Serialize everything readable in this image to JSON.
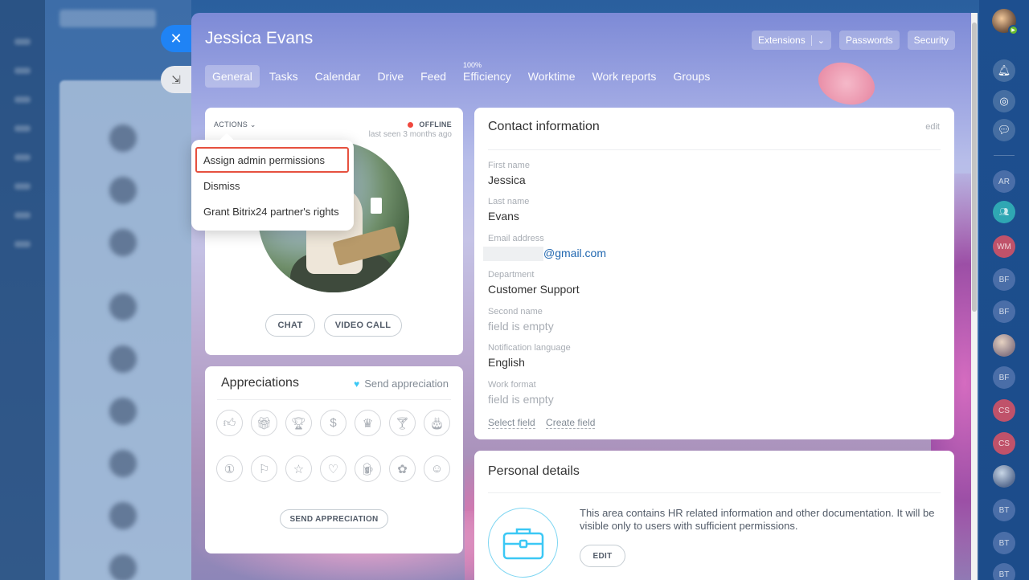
{
  "slider": {
    "title": "Jessica Evans",
    "close_icon": "close-icon",
    "minimize_icon": "minimize-icon",
    "top_buttons": {
      "extensions": "Extensions",
      "passwords": "Passwords",
      "security": "Security"
    },
    "tabs": [
      {
        "label": "General",
        "active": true
      },
      {
        "label": "Tasks"
      },
      {
        "label": "Calendar"
      },
      {
        "label": "Drive"
      },
      {
        "label": "Feed"
      },
      {
        "label": "Efficiency",
        "badge": "100%"
      },
      {
        "label": "Worktime"
      },
      {
        "label": "Work reports"
      },
      {
        "label": "Groups"
      }
    ]
  },
  "profile": {
    "actions_label": "ACTIONS",
    "status": "OFFLINE",
    "last_seen": "last seen 3 months ago",
    "chat_button": "CHAT",
    "video_call_button": "VIDEO CALL",
    "status_color": "#f0483e"
  },
  "actions_menu": {
    "items": [
      {
        "label": "Assign admin permissions",
        "highlighted": true
      },
      {
        "label": "Dismiss"
      },
      {
        "label": "Grant Bitrix24 partner's rights"
      }
    ]
  },
  "appreciations": {
    "title": "Appreciations",
    "send_link": "Send appreciation",
    "send_button": "SEND APPRECIATION",
    "icons": [
      "thumbs-up-icon",
      "gift-icon",
      "trophy-icon",
      "money-bag-icon",
      "crown-icon",
      "cocktail-icon",
      "cake-icon",
      "number-one-icon",
      "flag-icon",
      "star-icon",
      "heart-icon",
      "beer-icon",
      "flower-icon",
      "smile-icon"
    ]
  },
  "contact": {
    "title": "Contact information",
    "edit": "edit",
    "fields": {
      "first_name": {
        "label": "First name",
        "value": "Jessica"
      },
      "last_name": {
        "label": "Last name",
        "value": "Evans"
      },
      "email": {
        "label": "Email address",
        "value": "@gmail.com"
      },
      "department": {
        "label": "Department",
        "value": "Customer Support"
      },
      "second_name": {
        "label": "Second name",
        "value": "field is empty"
      },
      "notification_language": {
        "label": "Notification language",
        "value": "English"
      },
      "work_format": {
        "label": "Work format",
        "value": "field is empty"
      }
    },
    "select_field": "Select field",
    "create_field": "Create field"
  },
  "personal": {
    "title": "Personal details",
    "text": "This area contains HR related information and other documentation. It will be visible only to users with sufficient permissions.",
    "edit_button": "EDIT",
    "accent": "#3bc8f5"
  },
  "right_bar": {
    "users": [
      {
        "initials": "AR",
        "color": "#4a6ea8"
      },
      {
        "initials": "",
        "color": "#2fa7b3",
        "icon": "group-icon"
      },
      {
        "initials": "WM",
        "color": "#c0526a"
      },
      {
        "initials": "BF",
        "color": "#4a6ea8"
      },
      {
        "initials": "BF",
        "color": "#4a6ea8"
      },
      {
        "initials": "",
        "color": "#7b8aa6",
        "icon": "avatar-photo"
      },
      {
        "initials": "BF",
        "color": "#4a6ea8"
      },
      {
        "initials": "CS",
        "color": "#c0526a"
      },
      {
        "initials": "CS",
        "color": "#c0526a"
      },
      {
        "initials": "",
        "color": "#6b7fa6",
        "icon": "avatar-photo"
      },
      {
        "initials": "BT",
        "color": "#4a6ea8"
      },
      {
        "initials": "BT",
        "color": "#4a6ea8"
      },
      {
        "initials": "BT",
        "color": "#4a6ea8"
      }
    ]
  }
}
